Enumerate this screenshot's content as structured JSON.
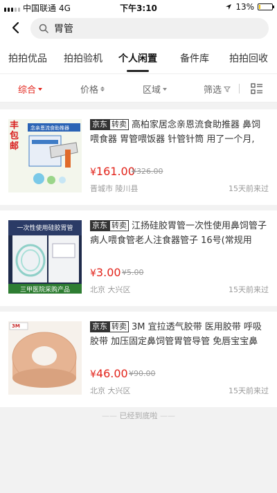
{
  "status": {
    "carrier": "中国联通",
    "network": "4G",
    "time": "下午3:10",
    "battery_text": "13%",
    "battery_level": 0.13
  },
  "search": {
    "query": "胃管"
  },
  "tabs": [
    {
      "label": "拍拍优品"
    },
    {
      "label": "拍拍验机"
    },
    {
      "label": "个人闲置",
      "active": true
    },
    {
      "label": "备件库"
    },
    {
      "label": "拍拍回收"
    }
  ],
  "filters": {
    "sort": "综合",
    "price": "价格",
    "region": "区域",
    "filter": "筛选"
  },
  "tag": {
    "platform": "京东",
    "type": "转卖"
  },
  "products": [
    {
      "title": "高柏家居念亲恩流食助推器 鼻饲喂食器 胃管喂饭器 针管针筒 用了一个月,",
      "currency": "¥",
      "price": "161.00",
      "original_price": "¥326.00",
      "location": "晋城市 陵川县",
      "posted": "15天前来过",
      "thumb": {
        "text": "丰包邮",
        "caption": "念亲恩流食助推器",
        "bg": "#f4f7ee",
        "accent": "#d81b1b"
      }
    },
    {
      "title": "江扬硅胶胃管一次性使用鼻饲管子病人喂食管老人注食器管子 16号(常规用",
      "currency": "¥",
      "price": "3.00",
      "original_price": "¥5.00",
      "location": "北京 大兴区",
      "posted": "15天前来过",
      "thumb": {
        "text": "一次性使用硅胶胃管",
        "caption": "三甲医院采购产品",
        "bg": "#1e2a4a",
        "accent": "#2e7d32"
      }
    },
    {
      "title": "3M 宜拉透气胶带 医用胶带 呼吸胶带 加压固定鼻饲管胃管导管 免唇宝宝鼻",
      "currency": "¥",
      "price": "46.00",
      "original_price": "¥90.00",
      "location": "北京 大兴区",
      "posted": "15天前来过",
      "thumb": {
        "text": "3M",
        "caption": "",
        "bg": "#f5f0ea",
        "accent": "#e8b89a"
      }
    }
  ],
  "end_text": "已经到底啦",
  "colors": {
    "accent": "#e2231a",
    "battery": "#f5c400"
  }
}
